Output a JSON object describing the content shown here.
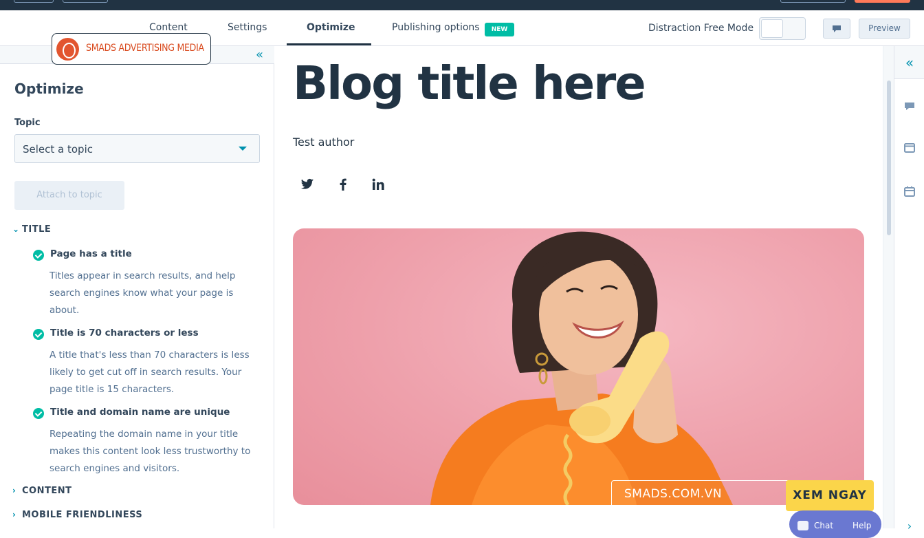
{
  "tabs": [
    {
      "label": "Content",
      "active": false
    },
    {
      "label": "Settings",
      "active": false
    },
    {
      "label": "Optimize",
      "active": true
    },
    {
      "label": "Publishing options",
      "active": false,
      "badge": "NEW"
    }
  ],
  "toolbar": {
    "distraction_free_label": "Distraction Free Mode",
    "distraction_free_on": false,
    "comments_icon": "comment-icon",
    "preview_label": "Preview"
  },
  "overlay_logo": {
    "text": "SMADS ADVERTISING MEDIA"
  },
  "left_panel": {
    "collapse_icon": "double-chevron-left-icon",
    "title": "Optimize",
    "topic_label": "Topic",
    "topic_select_value": "Select a topic",
    "attach_button": "Attach to topic",
    "sections": [
      {
        "label": "TITLE",
        "expanded": true
      },
      {
        "label": "CONTENT",
        "expanded": false
      },
      {
        "label": "MOBILE FRIENDLINESS",
        "expanded": false
      }
    ],
    "title_checks": [
      {
        "title": "Page has a title",
        "desc": "Titles appear in search results, and help search engines know what your page is about."
      },
      {
        "title": "Title is 70 characters or less",
        "desc": "A title that's less than 70 characters is less likely to get cut off in search results. Your page title is 15 characters."
      },
      {
        "title": "Title and domain name are unique",
        "desc": "Repeating the domain name in your title makes this content look less trustworthy to search engines and visitors."
      }
    ]
  },
  "editor": {
    "blog_title": "Blog title here",
    "author": "Test author",
    "social_icons": [
      "twitter-icon",
      "facebook-icon",
      "linkedin-icon"
    ],
    "hero_image": "woman-on-phone-pink-background"
  },
  "right_rail": {
    "icons": [
      "double-chevron-left-icon",
      "comment-icon",
      "browser-window-icon",
      "calendar-icon"
    ]
  },
  "ad_bar": {
    "url": "SMADS.COM.VN",
    "cta": "XEM NGAY"
  },
  "chat_widget": {
    "chat_label": "Chat",
    "help_label": "Help"
  },
  "colors": {
    "dark_nav": "#213343",
    "accent_teal": "#00bda5",
    "link_blue": "#0091ae",
    "cta_yellow": "#fbd54a",
    "hero_pink": "#eea0ab"
  }
}
